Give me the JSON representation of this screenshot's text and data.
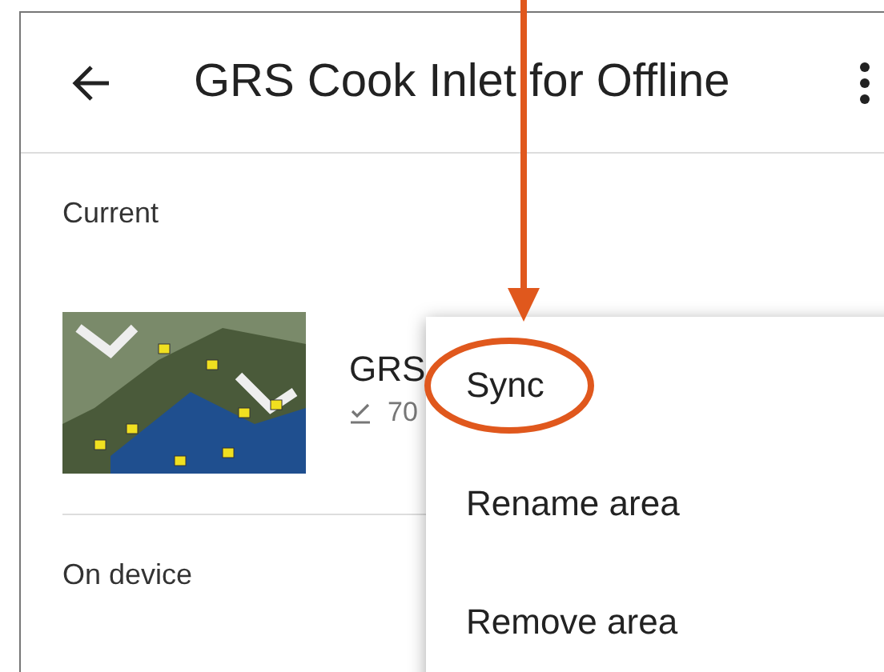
{
  "app_bar": {
    "title": "GRS Cook Inlet for Offline"
  },
  "sections": [
    {
      "heading": "Current",
      "areas": [
        {
          "name": "GRS",
          "detail": "70"
        }
      ]
    },
    {
      "heading": "On device"
    }
  ],
  "menu": {
    "items": [
      {
        "label": "Sync",
        "highlighted": true
      },
      {
        "label": "Rename area",
        "highlighted": false
      },
      {
        "label": "Remove area",
        "highlighted": false
      }
    ]
  }
}
